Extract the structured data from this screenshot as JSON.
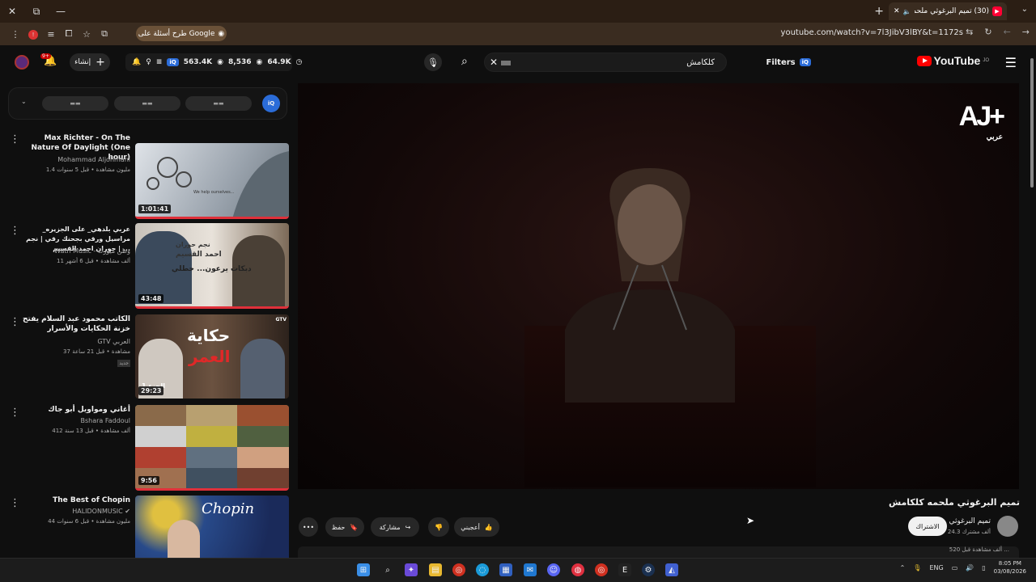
{
  "browser": {
    "tab_title": "(30) تميم البرغوثي ملحمه كلكا",
    "omnibox_label": "طرح أسئلة على Google",
    "url": "youtube.com/watch?v=7l3JibV3lBY&t=1172s"
  },
  "header": {
    "logo_text": "YouTube",
    "logo_region": "JO",
    "filters_label": "Filters",
    "iq_label": "iQ",
    "search_query": "كلكامش",
    "create_label": "إنشاء",
    "notif_count": "9+",
    "stats": [
      "563.4K",
      "8,536",
      "64.9K"
    ]
  },
  "chips": {
    "labels": [
      "▬▬",
      "▬▬",
      "▬▬"
    ],
    "iq_label": "iQ"
  },
  "recommendations": [
    {
      "title": "Max Richter - On The Nature Of Daylight (One hour)",
      "channel": "Mohammad Aljohmani",
      "meta": "1.4 مليون مشاهدة • قبل 5 سنوات",
      "duration": "1:01:41"
    },
    {
      "title": "عربي بلدهي_ على الجزيره_ مراسيل ورقي بجحنك رقي | نجم حوران احمد القسيم | ...",
      "channel": "Watn Music - وطن ميوزك",
      "meta": "11 ألف مشاهدة • قبل 6 أشهر",
      "duration": "43:48"
    },
    {
      "title": "الكاتب محمود عبد السلام يفتح خزنة الحكايات والأسرار",
      "channel": "GTV العربي",
      "meta": "37 مشاهدة • قبل 21 ساعة",
      "duration": "29:23",
      "badge": "جديد"
    },
    {
      "title": "أغاني ومواويل أبو جاك",
      "channel": "Bshara Faddoul",
      "meta": "412 ألف مشاهدة • قبل 13 سنة",
      "duration": "9:56"
    },
    {
      "title": "The Best of Chopin",
      "channel": "HALIDONMUSIC",
      "meta": "44 مليون مشاهدة • قبل 6 سنوات",
      "duration": ""
    }
  ],
  "thumb_text": {
    "rec2_line1": "نجم حوران",
    "rec2_line2": "احمد القسيم",
    "rec2_line3": "دبكات يرعون... حطلي",
    "rec3_line1": "حكاية",
    "rec3_line2": "العمر",
    "rec3_tag": "GTV",
    "rec3_part": "الجزء 1",
    "rec5_text": "Chopin",
    "rec1_caption": "We help ourselves..."
  },
  "video": {
    "title": "تميم البرغوثي ملحمه كلكامش",
    "channel": "تميم البرغوثي",
    "subscribers": "24.3 ألف مشترك",
    "subscribe_label": "الاشتراك",
    "like_label": "أعجبني",
    "share_label": "مشاركة",
    "save_label": "حفظ",
    "views_partial": "520 ألف مشاهدة قبل ...",
    "watermark": "عربي",
    "watermark_logo": "AJ+"
  },
  "taskbar": {
    "lang": "ENG",
    "time": "8:05 PM",
    "date": "03/08/2026"
  },
  "colors": {
    "accent": "#ff0000",
    "iq_blue": "#2b6cd8",
    "omnibox": "#6a5138"
  }
}
